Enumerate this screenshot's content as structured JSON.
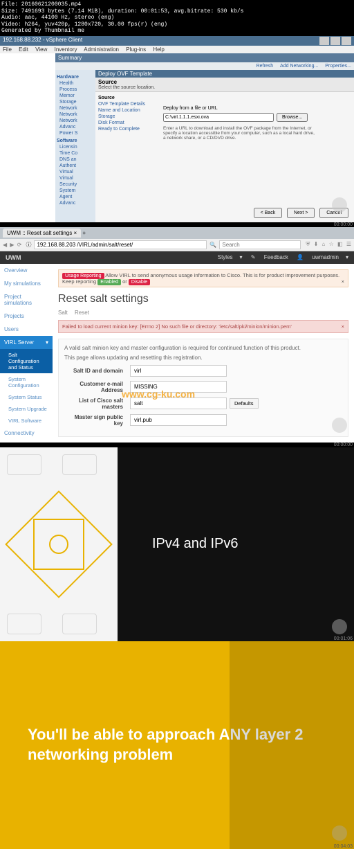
{
  "meta": {
    "file": "File: 20160621200035.mp4",
    "size": "Size: 7491693 bytes (7.14 MiB), duration: 00:01:53, avg.bitrate: 530 kb/s",
    "audio": "Audio: aac, 44100 Hz, stereo (eng)",
    "video": "Video: h264, yuv420p, 1280x720, 30.00 fps(r) (eng)",
    "gen": "Generated by Thumbnail me"
  },
  "vsphere": {
    "title": "192.168.88.232 - vSphere Client",
    "menu": [
      "File",
      "Edit",
      "View",
      "Inventory",
      "Administration",
      "Plug-ins",
      "Help"
    ],
    "tab": "Summary",
    "toolbar": {
      "refresh": "Refresh",
      "addnet": "Add Networking...",
      "props": "Properties..."
    },
    "sidebar": {
      "hardware": "Hardware",
      "hw_items": [
        "Health",
        "Process",
        "Memor",
        "Storage",
        "Network",
        "Network",
        "Network",
        "Advanc",
        "Power S"
      ],
      "software": "Software",
      "sw_items": [
        "Licensin",
        "Time Co",
        "DNS an",
        "Authent",
        "Virtual",
        "Virtual",
        "Security",
        "System",
        "Agent",
        "Advanc"
      ]
    },
    "wizard": {
      "win_title": "Deploy OVF Template",
      "head": "Source",
      "sub": "Select the source location.",
      "nav": [
        "Source",
        "OVF Template Details",
        "Name and Location",
        "Storage",
        "Disk Format",
        "Ready to Complete"
      ],
      "label": "Deploy from a file or URL",
      "path_value": "C:\\virl.1.1.1.esxi.ova",
      "browse": "Browse...",
      "hint": "Enter a URL to download and install the OVF package from the Internet, or specify a location accessible from your computer, such as a local hard drive, a network share, or a CD/DVD drive.",
      "back": "< Back",
      "next": "Next >",
      "cancel": "Cancel"
    },
    "time": "00:00:00"
  },
  "browser": {
    "tab_title": "UWM :: Reset salt settings",
    "url": "192.168.88.203 /VIRL/admin/salt/reset/",
    "search_placeholder": "Search"
  },
  "uwm": {
    "logo": "UWM",
    "styles": "Styles",
    "feedback": "Feedback",
    "user": "uwmadmin",
    "side": {
      "overview": "Overview",
      "mysim": "My simulations",
      "projsim": "Project simulations",
      "projects": "Projects",
      "users": "Users",
      "virl": "VIRL Server",
      "salt": "Salt Configuration and Status",
      "sysconf": "System Configuration",
      "sysstat": "System Status",
      "sysup": "System Upgrade",
      "virlsw": "VIRL Software",
      "conn": "Connectivity"
    },
    "alert_badge": "Usage Reporting",
    "alert_text": "Allow VIRL to send anonymous usage information to Cisco. This is for product improvement purposes. Keep reporting",
    "enabled": "Enabled",
    "disable": "Disable",
    "or": "or",
    "h1": "Reset salt settings",
    "crumb": [
      "Salt",
      "Reset"
    ],
    "err": "Failed to load current minion key: [Errno 2] No such file or directory: '/etc/salt/pki/minion/minion.pem'",
    "well1": "A valid salt minion key and master configuration is required for continued function of this product.",
    "well2": "This page allows updating and resetting this registration.",
    "f1_label": "Salt ID and domain",
    "f1_value": "virl",
    "f2_label": "Customer e-mail Address",
    "f2_value": "MISSING",
    "f3_label": "List of Cisco salt masters",
    "f3_value": "salt",
    "default_btn": "Defaults",
    "f4_label": "Master sign public key",
    "f4_value": "virl.pub",
    "time": "00:00:00",
    "watermark": "www.cg-ku.com"
  },
  "s3": {
    "title": "IPv4 and IPv6",
    "time": "00:01:06"
  },
  "s4": {
    "title": "You'll be able to approach ANY layer 2 networking problem",
    "time": "00:04:03"
  }
}
